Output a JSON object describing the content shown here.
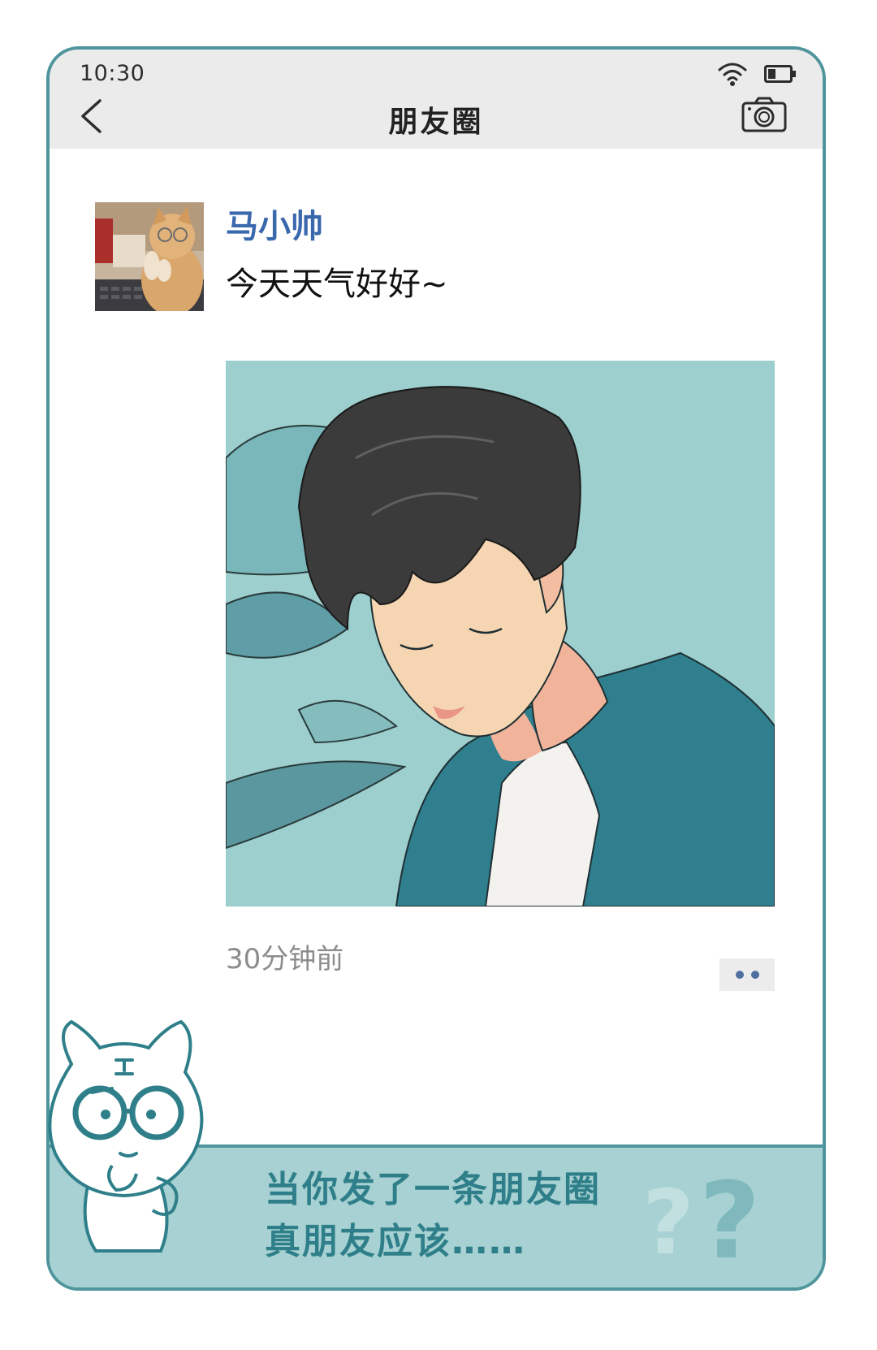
{
  "status_bar": {
    "time": "10:30"
  },
  "header": {
    "title": "朋友圈"
  },
  "post": {
    "username": "马小帅",
    "text": "今天天气好好~",
    "timestamp": "30分钟前"
  },
  "banner": {
    "line1": "当你发了一条朋友圈",
    "line2": "真朋友应该……"
  },
  "icons": {
    "back": "chevron-left-icon",
    "camera": "camera-icon",
    "wifi": "wifi-icon",
    "battery": "battery-icon",
    "more": "more-dots-icon"
  },
  "colors": {
    "frame": "#4f959d",
    "username": "#3a68ad",
    "banner_bg": "#a7d1d2",
    "banner_text": "#2f7f8a",
    "topbar_bg": "#ebebeb"
  }
}
